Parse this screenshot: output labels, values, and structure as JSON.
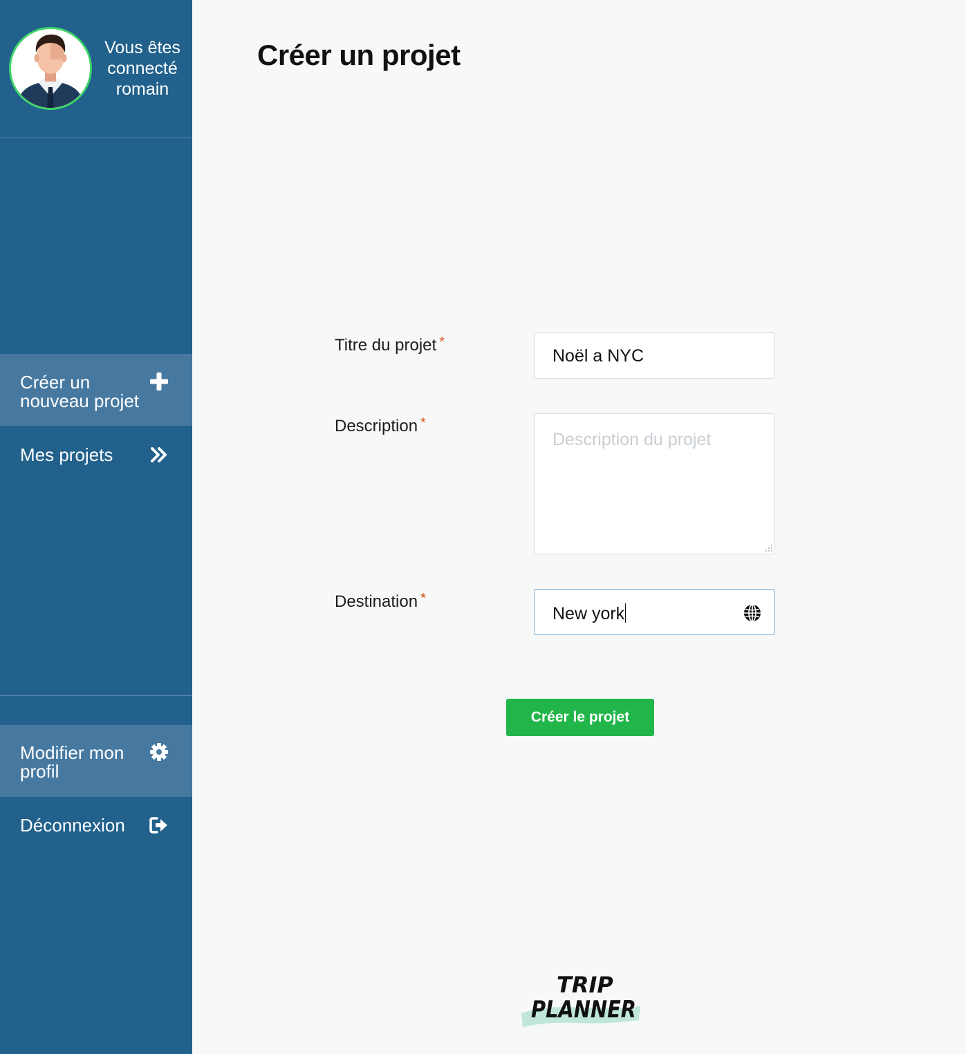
{
  "user": {
    "line1": "Vous êtes",
    "line2": "connecté",
    "line3": "romain"
  },
  "sidebar": {
    "items": [
      {
        "line1": "Créer un",
        "line2": "nouveau projet",
        "icon": "plus-icon"
      },
      {
        "label": "Mes projets",
        "icon": "double-chevron-right-icon"
      },
      {
        "line1": "Modifier mon",
        "line2": "profil",
        "icon": "gear-icon"
      },
      {
        "label": "Déconnexion",
        "icon": "sign-out-icon"
      }
    ]
  },
  "main": {
    "title": "Créer un projet",
    "form": {
      "title_label": "Titre du projet",
      "title_value": "Noël a NYC",
      "description_label": "Description",
      "description_placeholder": "Description du projet",
      "destination_label": "Destination",
      "destination_value": "New york",
      "required_mark": "*",
      "submit_label": "Créer le projet"
    },
    "logo": {
      "line1": "TRIP",
      "line2": "PLANNER"
    }
  },
  "colors": {
    "sidebar": "#21618c",
    "sidebar_active": "#4779a0",
    "accent_green": "#22b64a",
    "required": "#d9531e"
  }
}
